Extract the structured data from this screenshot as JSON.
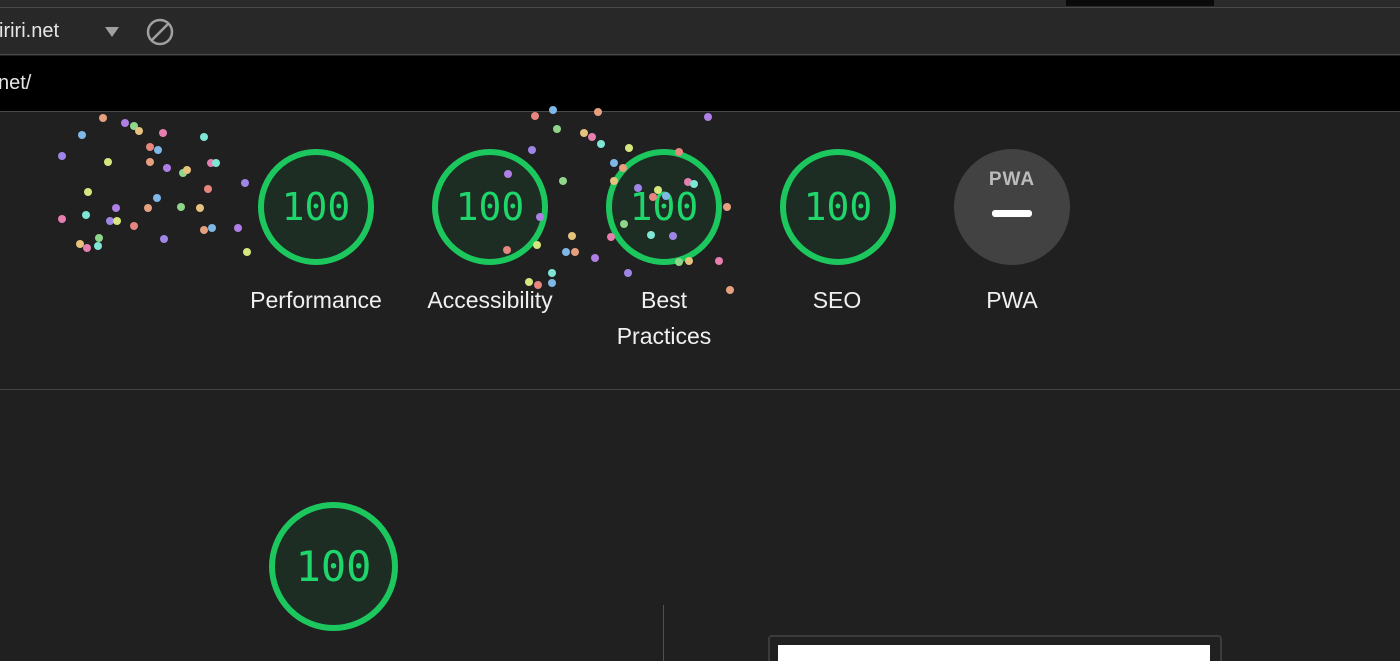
{
  "toolbar": {
    "site_name": "iriri.net"
  },
  "url_bar": {
    "url": "net/"
  },
  "scores": [
    {
      "label": "Performance",
      "value": "100"
    },
    {
      "label": "Accessibility",
      "value": "100"
    },
    {
      "label": "Best\nPractices",
      "value": "100"
    },
    {
      "label": "SEO",
      "value": "100"
    }
  ],
  "pwa": {
    "badge_text": "PWA",
    "label": "PWA"
  },
  "detail": {
    "score": "100"
  },
  "colors": {
    "pass_green": "#1cc85e",
    "background": "#202020",
    "pwa_gray": "#424242"
  }
}
